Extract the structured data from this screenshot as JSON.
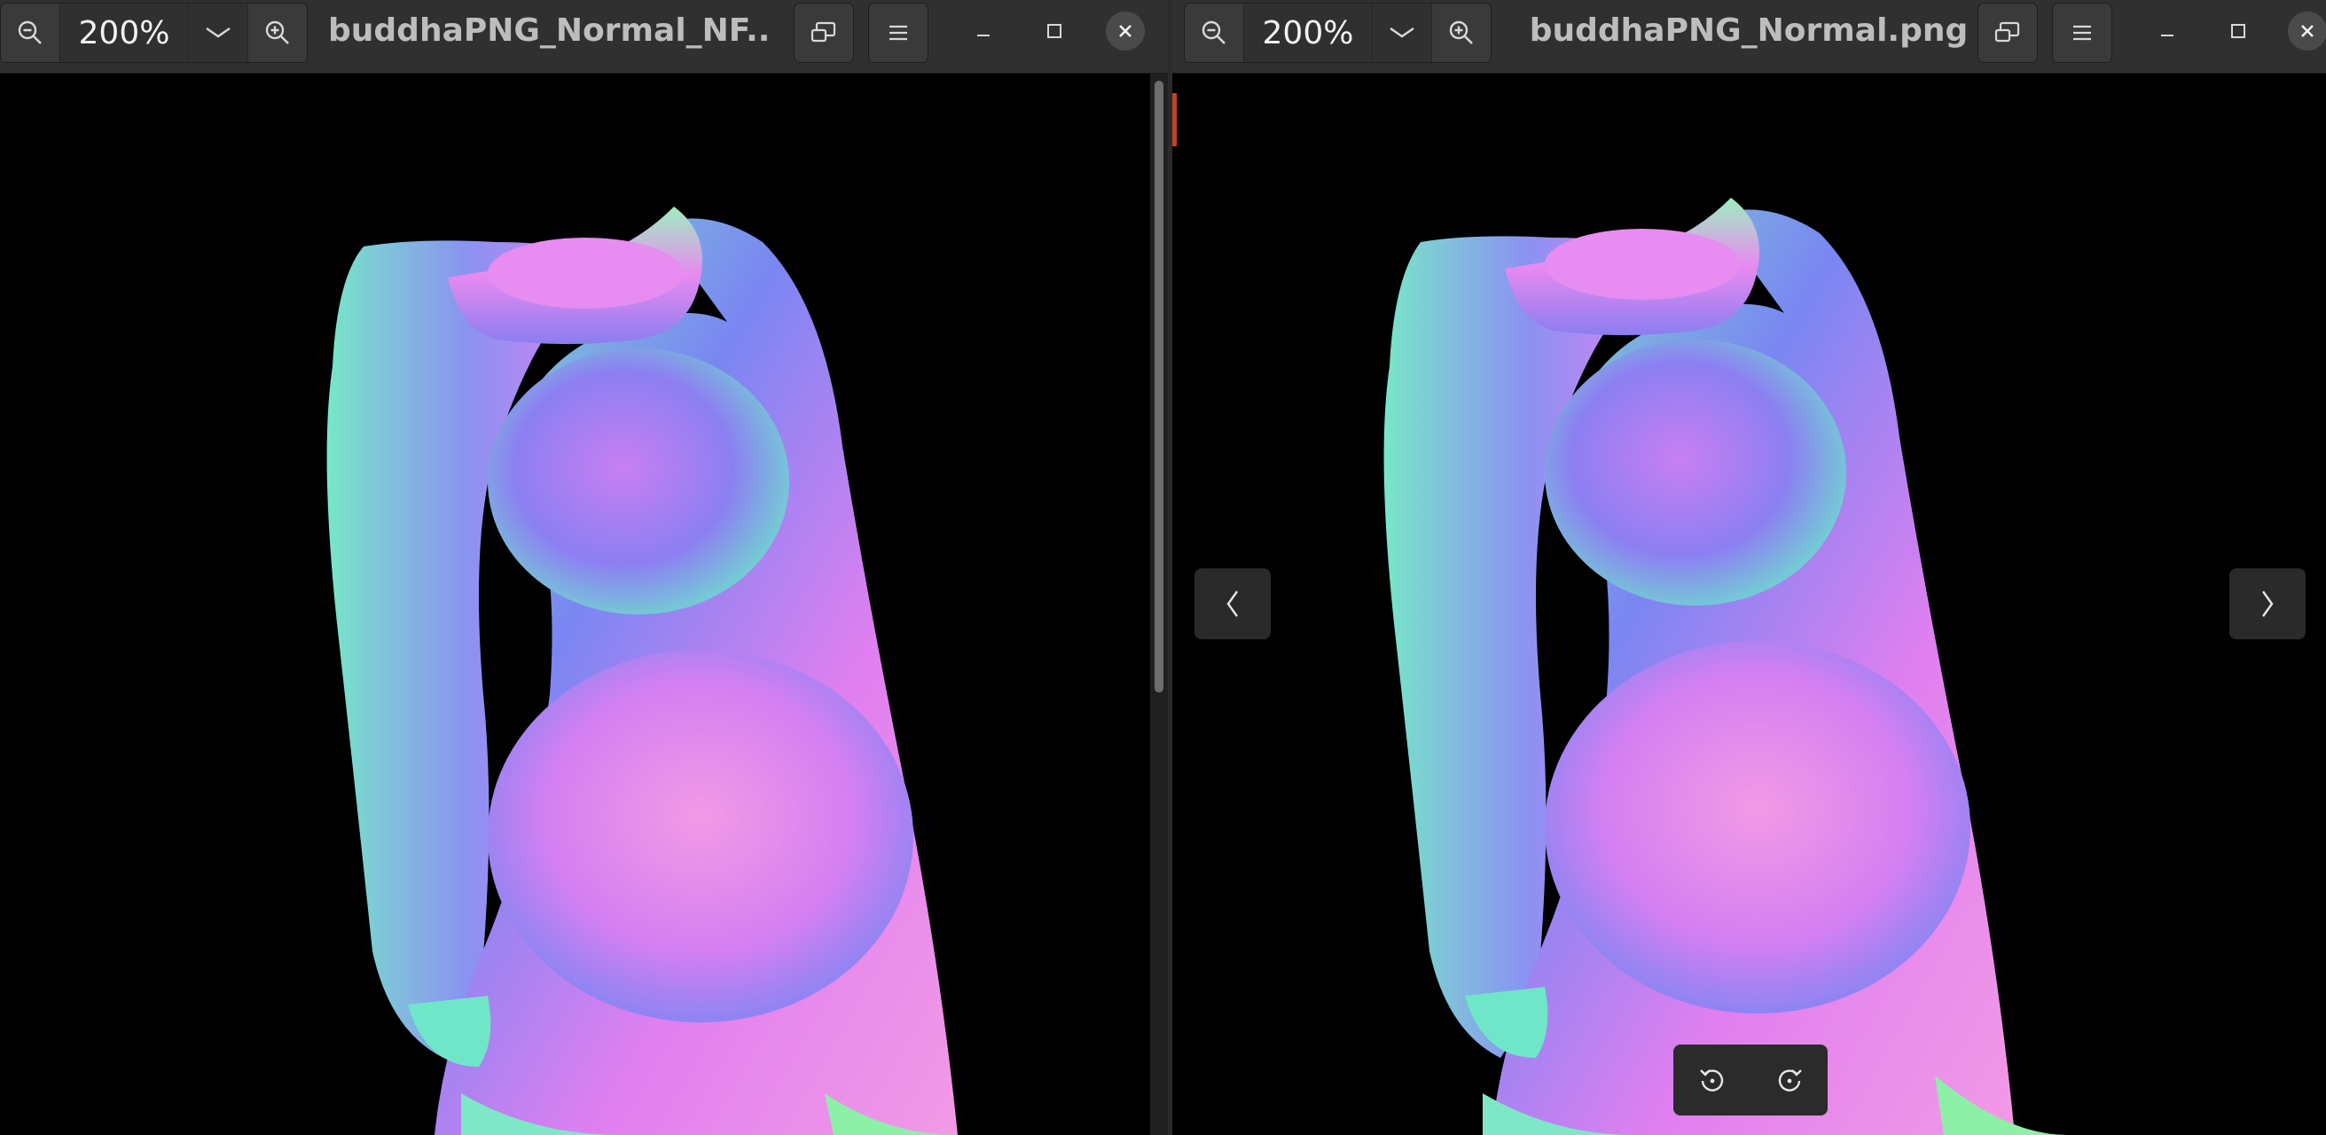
{
  "left_window": {
    "zoom": {
      "value": "200%"
    },
    "title": "buddhaPNG_Normal_NF...",
    "icons": {
      "zoom_out": "zoom-out-icon",
      "zoom_dropdown": "chevron-down-icon",
      "zoom_in": "zoom-in-icon",
      "view_mode": "view-mode-icon",
      "menu": "hamburger-menu-icon",
      "minimize": "minimize-icon",
      "maximize": "maximize-icon",
      "close": "close-icon"
    },
    "image": {
      "description_color_scheme": "normal-map"
    }
  },
  "right_window": {
    "zoom": {
      "value": "200%"
    },
    "title": "buddhaPNG_Normal.png",
    "icons": {
      "zoom_out": "zoom-out-icon",
      "zoom_dropdown": "chevron-down-icon",
      "zoom_in": "zoom-in-icon",
      "view_mode": "view-mode-icon",
      "menu": "hamburger-menu-icon",
      "minimize": "minimize-icon",
      "maximize": "maximize-icon",
      "close": "close-icon",
      "previous": "chevron-left-icon",
      "next": "chevron-right-icon",
      "rotate_left": "rotate-left-icon",
      "rotate_right": "rotate-right-icon"
    }
  },
  "colors": {
    "header_bg": "#303030",
    "canvas_bg": "#000000",
    "title_text": "#bdbdbd",
    "accent": "#c0461f",
    "normal_pink": "#e67ff0",
    "normal_blue": "#6a7cf0",
    "normal_cyan": "#6fe6c8",
    "normal_green": "#8ef0a6"
  }
}
